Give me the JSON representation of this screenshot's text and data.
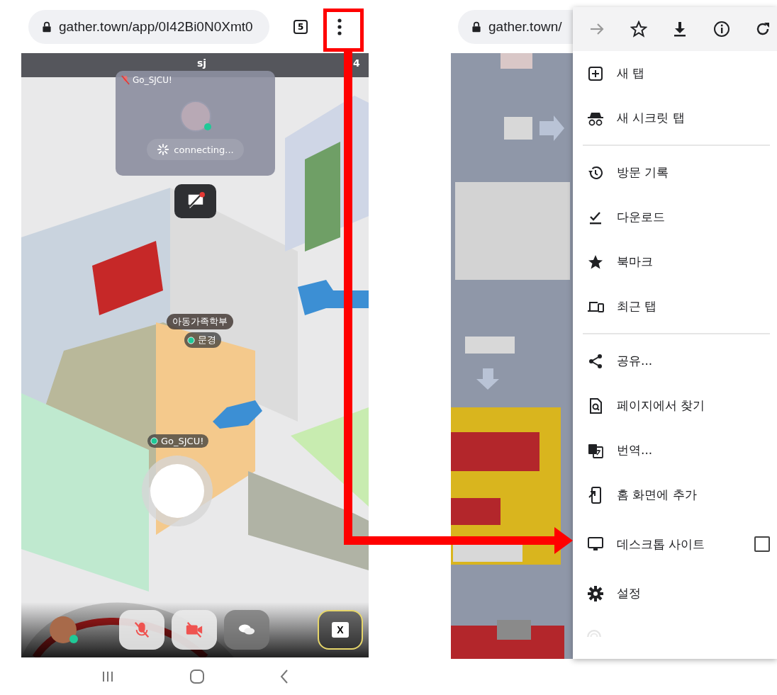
{
  "left_phone": {
    "address_bar": {
      "url": "gather.town/app/0I42Bi0N0Xmt0",
      "tab_count": "5"
    },
    "map": {
      "top_label": "sj",
      "corner_count": "4",
      "video_tile": {
        "name": "Go_SJCU!",
        "mic_muted": true,
        "status": "connecting..."
      },
      "name_tags": [
        {
          "text": "아동가족학부",
          "kind": "area"
        },
        {
          "text": "문경",
          "kind": "player"
        },
        {
          "text": "Go_SJCU!",
          "kind": "player"
        }
      ],
      "toolbar": [
        {
          "kind": "avatar"
        },
        {
          "kind": "mic",
          "off": true
        },
        {
          "kind": "camera",
          "off": true
        },
        {
          "kind": "chat",
          "off": false
        },
        {
          "kind": "key",
          "text": "X"
        }
      ]
    }
  },
  "right_phone": {
    "address_bar": {
      "url": "gather.town/"
    },
    "menu": {
      "toolbar": [
        {
          "kind": "forward",
          "disabled": true
        },
        {
          "kind": "star",
          "disabled": false
        },
        {
          "kind": "download",
          "disabled": false
        },
        {
          "kind": "info",
          "disabled": false
        },
        {
          "kind": "reload",
          "disabled": false
        }
      ],
      "groups": [
        [
          {
            "label": "새 탭"
          },
          {
            "label": "새 시크릿 탭"
          }
        ],
        [
          {
            "label": "방문 기록"
          },
          {
            "label": "다운로드"
          },
          {
            "label": "북마크"
          },
          {
            "label": "최근 탭"
          }
        ],
        [
          {
            "label": "공유..."
          },
          {
            "label": "페이지에서 찾기"
          },
          {
            "label": "번역..."
          },
          {
            "label": "홈 화면에 추가"
          },
          {
            "label": "데스크톱 사이트",
            "checked": false
          },
          {
            "label": "설정"
          },
          {
            "kind": "disabled"
          }
        ]
      ]
    }
  }
}
